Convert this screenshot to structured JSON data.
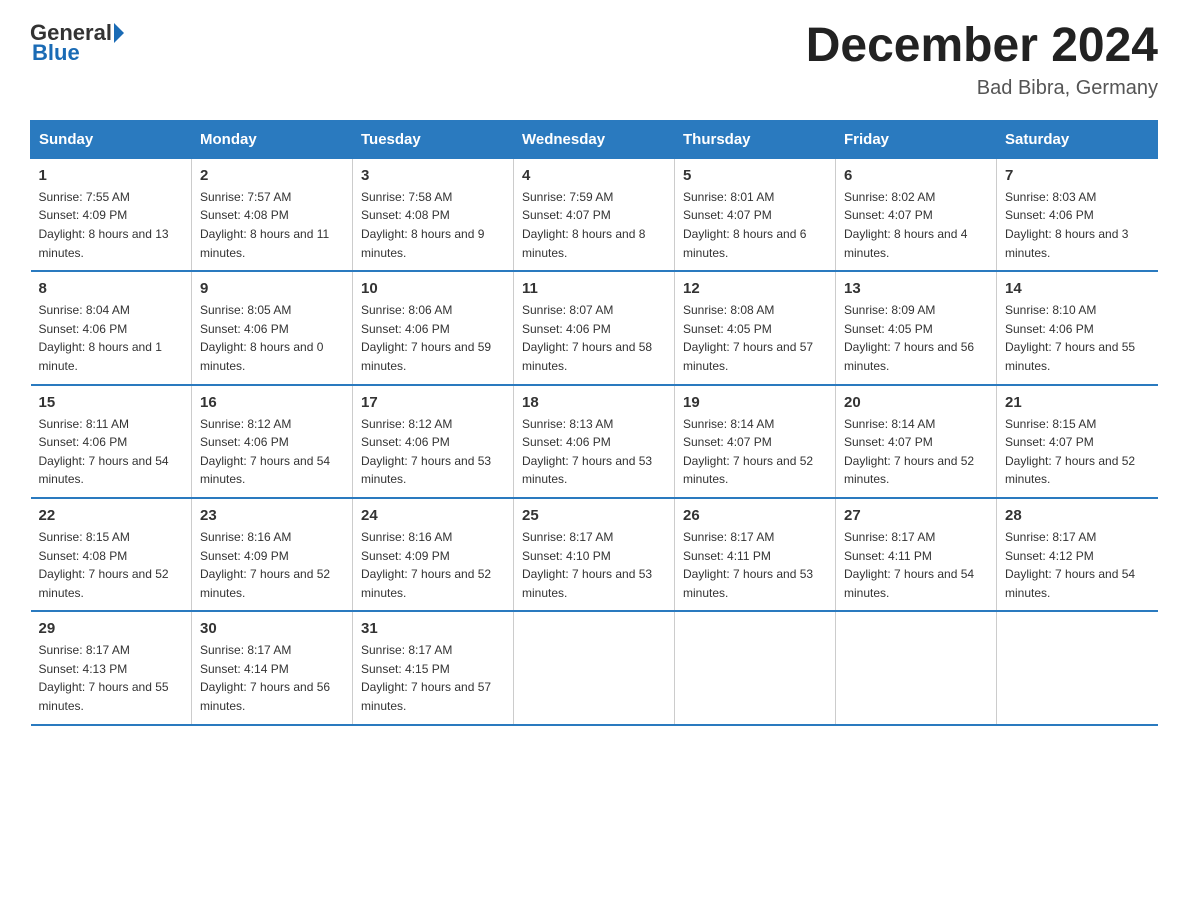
{
  "header": {
    "logo_general": "General",
    "logo_blue": "Blue",
    "month_title": "December 2024",
    "location": "Bad Bibra, Germany"
  },
  "days_of_week": [
    "Sunday",
    "Monday",
    "Tuesday",
    "Wednesday",
    "Thursday",
    "Friday",
    "Saturday"
  ],
  "weeks": [
    [
      {
        "day": "1",
        "sunrise": "7:55 AM",
        "sunset": "4:09 PM",
        "daylight": "8 hours and 13 minutes."
      },
      {
        "day": "2",
        "sunrise": "7:57 AM",
        "sunset": "4:08 PM",
        "daylight": "8 hours and 11 minutes."
      },
      {
        "day": "3",
        "sunrise": "7:58 AM",
        "sunset": "4:08 PM",
        "daylight": "8 hours and 9 minutes."
      },
      {
        "day": "4",
        "sunrise": "7:59 AM",
        "sunset": "4:07 PM",
        "daylight": "8 hours and 8 minutes."
      },
      {
        "day": "5",
        "sunrise": "8:01 AM",
        "sunset": "4:07 PM",
        "daylight": "8 hours and 6 minutes."
      },
      {
        "day": "6",
        "sunrise": "8:02 AM",
        "sunset": "4:07 PM",
        "daylight": "8 hours and 4 minutes."
      },
      {
        "day": "7",
        "sunrise": "8:03 AM",
        "sunset": "4:06 PM",
        "daylight": "8 hours and 3 minutes."
      }
    ],
    [
      {
        "day": "8",
        "sunrise": "8:04 AM",
        "sunset": "4:06 PM",
        "daylight": "8 hours and 1 minute."
      },
      {
        "day": "9",
        "sunrise": "8:05 AM",
        "sunset": "4:06 PM",
        "daylight": "8 hours and 0 minutes."
      },
      {
        "day": "10",
        "sunrise": "8:06 AM",
        "sunset": "4:06 PM",
        "daylight": "7 hours and 59 minutes."
      },
      {
        "day": "11",
        "sunrise": "8:07 AM",
        "sunset": "4:06 PM",
        "daylight": "7 hours and 58 minutes."
      },
      {
        "day": "12",
        "sunrise": "8:08 AM",
        "sunset": "4:05 PM",
        "daylight": "7 hours and 57 minutes."
      },
      {
        "day": "13",
        "sunrise": "8:09 AM",
        "sunset": "4:05 PM",
        "daylight": "7 hours and 56 minutes."
      },
      {
        "day": "14",
        "sunrise": "8:10 AM",
        "sunset": "4:06 PM",
        "daylight": "7 hours and 55 minutes."
      }
    ],
    [
      {
        "day": "15",
        "sunrise": "8:11 AM",
        "sunset": "4:06 PM",
        "daylight": "7 hours and 54 minutes."
      },
      {
        "day": "16",
        "sunrise": "8:12 AM",
        "sunset": "4:06 PM",
        "daylight": "7 hours and 54 minutes."
      },
      {
        "day": "17",
        "sunrise": "8:12 AM",
        "sunset": "4:06 PM",
        "daylight": "7 hours and 53 minutes."
      },
      {
        "day": "18",
        "sunrise": "8:13 AM",
        "sunset": "4:06 PM",
        "daylight": "7 hours and 53 minutes."
      },
      {
        "day": "19",
        "sunrise": "8:14 AM",
        "sunset": "4:07 PM",
        "daylight": "7 hours and 52 minutes."
      },
      {
        "day": "20",
        "sunrise": "8:14 AM",
        "sunset": "4:07 PM",
        "daylight": "7 hours and 52 minutes."
      },
      {
        "day": "21",
        "sunrise": "8:15 AM",
        "sunset": "4:07 PM",
        "daylight": "7 hours and 52 minutes."
      }
    ],
    [
      {
        "day": "22",
        "sunrise": "8:15 AM",
        "sunset": "4:08 PM",
        "daylight": "7 hours and 52 minutes."
      },
      {
        "day": "23",
        "sunrise": "8:16 AM",
        "sunset": "4:09 PM",
        "daylight": "7 hours and 52 minutes."
      },
      {
        "day": "24",
        "sunrise": "8:16 AM",
        "sunset": "4:09 PM",
        "daylight": "7 hours and 52 minutes."
      },
      {
        "day": "25",
        "sunrise": "8:17 AM",
        "sunset": "4:10 PM",
        "daylight": "7 hours and 53 minutes."
      },
      {
        "day": "26",
        "sunrise": "8:17 AM",
        "sunset": "4:11 PM",
        "daylight": "7 hours and 53 minutes."
      },
      {
        "day": "27",
        "sunrise": "8:17 AM",
        "sunset": "4:11 PM",
        "daylight": "7 hours and 54 minutes."
      },
      {
        "day": "28",
        "sunrise": "8:17 AM",
        "sunset": "4:12 PM",
        "daylight": "7 hours and 54 minutes."
      }
    ],
    [
      {
        "day": "29",
        "sunrise": "8:17 AM",
        "sunset": "4:13 PM",
        "daylight": "7 hours and 55 minutes."
      },
      {
        "day": "30",
        "sunrise": "8:17 AM",
        "sunset": "4:14 PM",
        "daylight": "7 hours and 56 minutes."
      },
      {
        "day": "31",
        "sunrise": "8:17 AM",
        "sunset": "4:15 PM",
        "daylight": "7 hours and 57 minutes."
      },
      null,
      null,
      null,
      null
    ]
  ],
  "labels": {
    "sunrise": "Sunrise:",
    "sunset": "Sunset:",
    "daylight": "Daylight:"
  }
}
